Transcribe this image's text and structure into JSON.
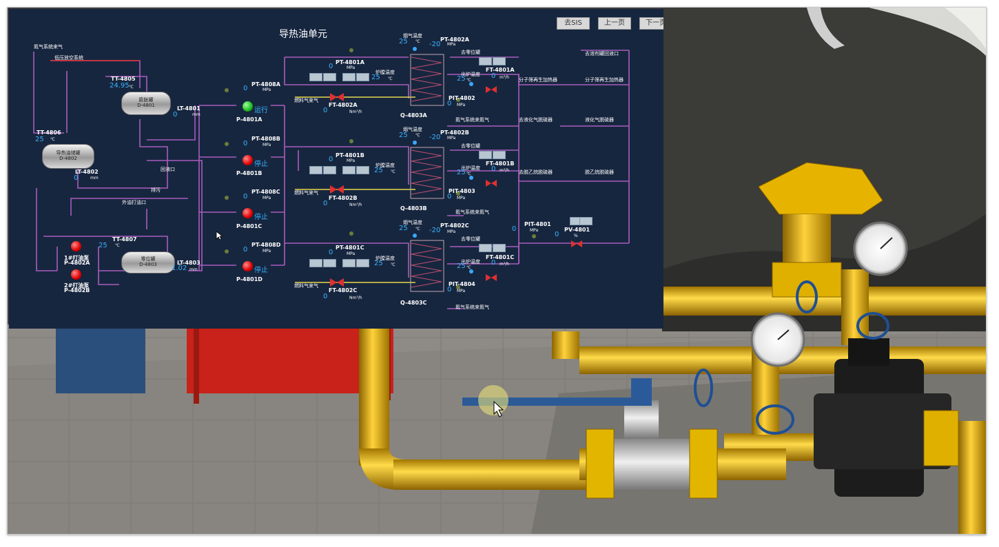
{
  "hmi": {
    "title": "导热油单元",
    "nav_buttons": [
      "去SIS",
      "上一页",
      "下一页"
    ],
    "labels": {
      "nitrogen_in": "氮气系统来气",
      "lp_vent": "低压放空系统",
      "return_port": "回液口",
      "drain": "排污",
      "external_fill": "外油打油口",
      "to_molsieve_return": "去溶剂罐回液口"
    },
    "tanks": [
      {
        "id": "D-4801",
        "name": "膨胀罐",
        "tag_tt": "TT-4805",
        "tt_val": "24.95",
        "tt_unit": "℃",
        "tag_lt": "LT-4801",
        "lt_val": "0",
        "lt_unit": "mm"
      },
      {
        "id": "D-4802",
        "name": "导热油储罐",
        "tag_tt": "TT-4806",
        "tt_val": "25",
        "tt_unit": "℃",
        "tag_lt": "LT-4802",
        "lt_val": "0",
        "lt_unit": "mm"
      },
      {
        "id": "D-4803",
        "name": "零位罐",
        "tag_tt": "TT-4807",
        "tt_val": "25",
        "tt_unit": "℃",
        "tag_lt": "LT-4803",
        "lt_val": "1.02",
        "lt_unit": "mm"
      }
    ],
    "circ_pumps": [
      {
        "id": "P-4801A",
        "tag_pt": "PT-4808A",
        "pt_val": "0",
        "unit": "MPa",
        "status": "运行",
        "running": true
      },
      {
        "id": "P-4801B",
        "tag_pt": "PT-4808B",
        "pt_val": "0",
        "unit": "MPa",
        "status": "停止",
        "running": false
      },
      {
        "id": "P-4801C",
        "tag_pt": "PT-4808C",
        "pt_val": "0",
        "unit": "MPa",
        "status": "停止",
        "running": false
      },
      {
        "id": "P-4801D",
        "tag_pt": "PT-4808D",
        "pt_val": "0",
        "unit": "MPa",
        "status": "停止",
        "running": false
      }
    ],
    "fill_pumps": [
      {
        "id": "P-4802A",
        "name": "1#打油泵"
      },
      {
        "id": "P-4802B",
        "name": "2#打油泵"
      }
    ],
    "heaters": [
      {
        "id": "Q-4803A",
        "fuel_label": "燃料气来气",
        "pt_tag": "PT-4801A",
        "pt_val": "0",
        "pt_unit": "MPa",
        "ft_tag": "FT-4802A",
        "ft_val": "0",
        "ft_unit": "Nm³/h",
        "furnace_temp_label": "炉膛温度",
        "furnace_temp": "25",
        "furnace_unit": "℃",
        "flue_label": "烟气温度",
        "flue_val": "25",
        "flue_unit": "℃",
        "pdt_tag": "PT-4802A",
        "pdt_val": "-20",
        "pdt_unit": "MPa",
        "to_zero": "去零位罐",
        "outlet_temp_label": "出炉温度",
        "outlet_temp": "25",
        "outlet_unit": "℃",
        "ft_out_tag": "FT-4801A",
        "ft_out_val": "0",
        "ft_out_unit": "m³/h",
        "pit_tag": "PIT-4802",
        "pit_val": "0",
        "pit_unit": "MPa",
        "n2_label": "氮气系统来氮气"
      },
      {
        "id": "Q-4803B",
        "fuel_label": "燃料气来气",
        "pt_tag": "PT-4801B",
        "pt_val": "0",
        "pt_unit": "MPa",
        "ft_tag": "FT-4802B",
        "ft_val": "0",
        "ft_unit": "Nm³/h",
        "furnace_temp_label": "炉膛温度",
        "furnace_temp": "25",
        "furnace_unit": "℃",
        "flue_label": "烟气温度",
        "flue_val": "25",
        "flue_unit": "℃",
        "pdt_tag": "PT-4802B",
        "pdt_val": "-20",
        "pdt_unit": "MPa",
        "to_zero": "去零位罐",
        "outlet_temp_label": "出炉温度",
        "outlet_temp": "25",
        "outlet_unit": "℃",
        "ft_out_tag": "FT-4801B",
        "ft_out_val": "0",
        "ft_out_unit": "m³/h",
        "pit_tag": "PIT-4803",
        "pit_val": "0",
        "pit_unit": "MPa",
        "n2_label": "氮气系统来氮气"
      },
      {
        "id": "Q-4803C",
        "fuel_label": "燃料气来气",
        "pt_tag": "PT-4801C",
        "pt_val": "0",
        "pt_unit": "MPa",
        "ft_tag": "FT-4802C",
        "ft_val": "0",
        "ft_unit": "Nm³/h",
        "furnace_temp_label": "炉膛温度",
        "furnace_temp": "25",
        "furnace_unit": "℃",
        "flue_label": "烟气温度",
        "flue_val": "25",
        "flue_unit": "℃",
        "pdt_tag": "PT-4802C",
        "pdt_val": "-20",
        "pdt_unit": "MPa",
        "to_zero": "去零位罐",
        "outlet_temp_label": "出炉温度",
        "outlet_temp": "25",
        "outlet_unit": "℃",
        "ft_out_tag": "FT-4801C",
        "ft_out_val": "0",
        "ft_out_unit": "m³/h",
        "pit_tag": "PIT-4804",
        "pit_val": "0",
        "pit_unit": "MPa",
        "n2_label": "氮气系统来氮气"
      }
    ],
    "outlets": [
      {
        "left": "分子筛再生加热器",
        "right": "分子筛再生加热器"
      },
      {
        "left": "去液化气脱硫器",
        "right": "液化气脱硫器"
      },
      {
        "left": "去脱乙烷脱硫器",
        "right": "脱乙烷脱硫器"
      }
    ],
    "return_header": {
      "pit_tag": "PIT-4801",
      "pit_val": "0",
      "pit_unit": "MPa",
      "pv_tag": "PV-4801",
      "pv_val": "0",
      "pv_unit": "%"
    }
  },
  "colors": {
    "hmi_bg": "#17263f",
    "pipe": "#b060c0",
    "value": "#37b4ff",
    "gas_line": "#e8d84a",
    "pipe_3d": "#e0b000",
    "floor": "#8a8782"
  },
  "icons": [
    "pump-icon",
    "valve-icon",
    "gauge-icon",
    "mouse-cursor-icon",
    "handwheel-icon"
  ]
}
